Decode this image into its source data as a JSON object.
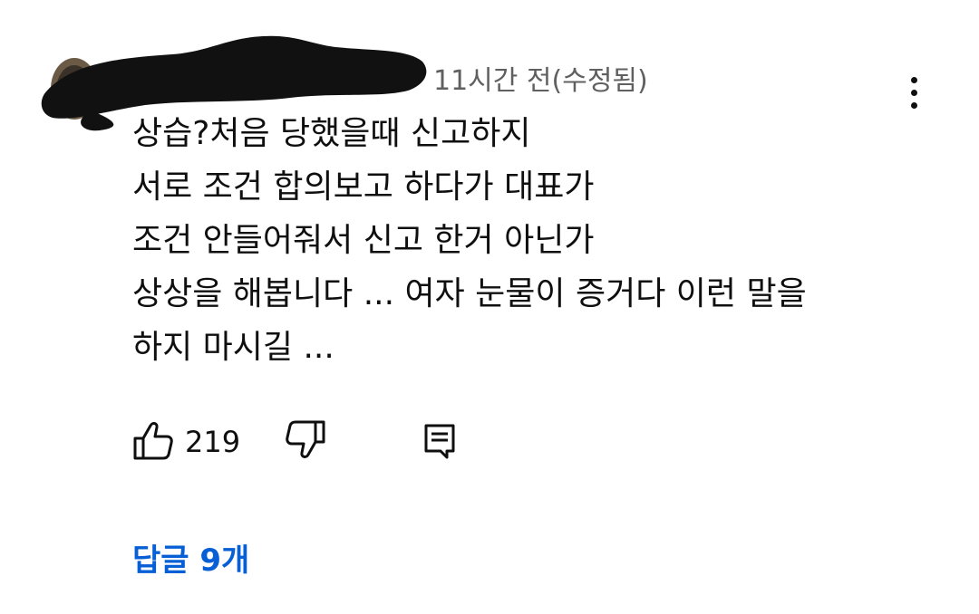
{
  "comment": {
    "timestamp": "11시간 전(수정됨)",
    "lines": [
      "상습?처음 당했을때 신고하지",
      "서로 조건 합의보고 하다가 대표가",
      "조건 안들어줘서 신고 한거 아닌가",
      "상상을 해봅니다 ... 여자 눈물이 증거다 이런 말을",
      "하지 마시길 ..."
    ],
    "like_count": "219",
    "replies_label": "답글 9개"
  },
  "icons": {
    "more": "more-vert-icon",
    "like": "thumb-up-icon",
    "dislike": "thumb-down-icon",
    "reply": "comment-icon"
  },
  "colors": {
    "text": "#0f0f0f",
    "secondary_text": "#606060",
    "link": "#065fd4",
    "redaction": "#111111"
  }
}
